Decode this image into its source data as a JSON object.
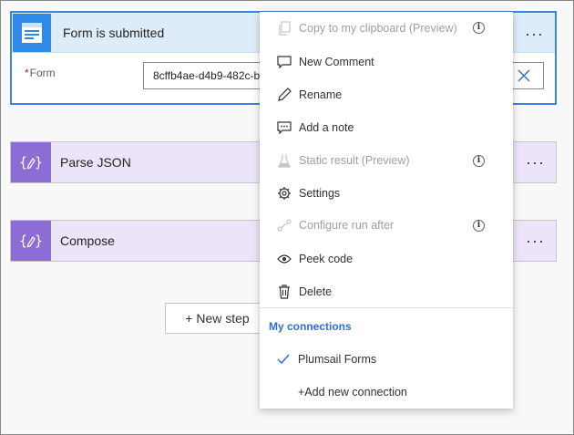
{
  "trigger": {
    "title": "Form is submitted",
    "form_label": "Form",
    "required_marker": "*",
    "form_value": "8cffb4ae-d4b9-482c-b",
    "more_label": "···",
    "icon": "form-icon",
    "header_color": "#deecfa",
    "icon_bg": "#2e8ae6",
    "border_color": "#3d86d6"
  },
  "actions": [
    {
      "title": "Parse JSON",
      "icon": "data-operation-icon",
      "more_label": "···"
    },
    {
      "title": "Compose",
      "icon": "data-operation-icon",
      "more_label": "···"
    }
  ],
  "action_colors": {
    "card_bg": "#ece5f9",
    "icon_bg": "#8c6cd5"
  },
  "new_step": {
    "label": "+ New step"
  },
  "menu": {
    "items": [
      {
        "label": "Copy to my clipboard (Preview)",
        "icon": "copy-icon",
        "disabled": true,
        "info": true
      },
      {
        "label": "New Comment",
        "icon": "comment-icon",
        "disabled": false,
        "info": false
      },
      {
        "label": "Rename",
        "icon": "pencil-icon",
        "disabled": false,
        "info": false
      },
      {
        "label": "Add a note",
        "icon": "note-icon",
        "disabled": false,
        "info": false
      },
      {
        "label": "Static result (Preview)",
        "icon": "flask-icon",
        "disabled": true,
        "info": true
      },
      {
        "label": "Settings",
        "icon": "gear-icon",
        "disabled": false,
        "info": false
      },
      {
        "label": "Configure run after",
        "icon": "run-after-icon",
        "disabled": true,
        "info": true
      },
      {
        "label": "Peek code",
        "icon": "eye-icon",
        "disabled": false,
        "info": false
      },
      {
        "label": "Delete",
        "icon": "trash-icon",
        "disabled": false,
        "info": false
      }
    ],
    "info_glyph": "i",
    "connections_heading": "My connections",
    "connections": [
      {
        "label": "Plumsail Forms",
        "selected": true
      },
      {
        "label": "+Add new connection",
        "selected": false
      }
    ],
    "accent_color": "#2f6fd0"
  }
}
